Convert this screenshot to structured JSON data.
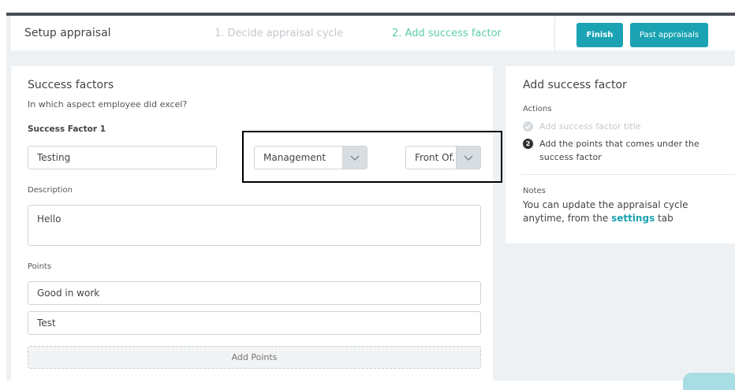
{
  "header": {
    "title": "Setup appraisal",
    "step1": "1. Decide appraisal cycle",
    "step2": "2. Add success factor",
    "finish_label": "Finish",
    "past_label": "Past appraisals"
  },
  "form": {
    "section_title": "Success factors",
    "subtitle": "In which aspect employee did excel?",
    "factor_label": "Success Factor 1",
    "factor_value": "Testing",
    "category_select": "Management",
    "dept_select": "Front Of.",
    "description_label": "Description",
    "description_value": "Hello",
    "points_label": "Points",
    "points": [
      "Good in work",
      "Test"
    ],
    "add_points_label": "Add Points"
  },
  "side": {
    "title": "Add success factor",
    "actions_label": "Actions",
    "actions": [
      {
        "text": "Add success factor title",
        "state": "done"
      },
      {
        "text": "Add the points that comes under the success factor",
        "state": "current",
        "num": "2"
      }
    ],
    "notes_label": "Notes",
    "notes_prefix": "You can update the appraisal cycle anytime, from the ",
    "notes_link": "settings",
    "notes_suffix": " tab"
  },
  "colors": {
    "accent": "#1ba3b3",
    "step_active": "#5ccfa3",
    "step_inactive": "#c3c9cf"
  }
}
